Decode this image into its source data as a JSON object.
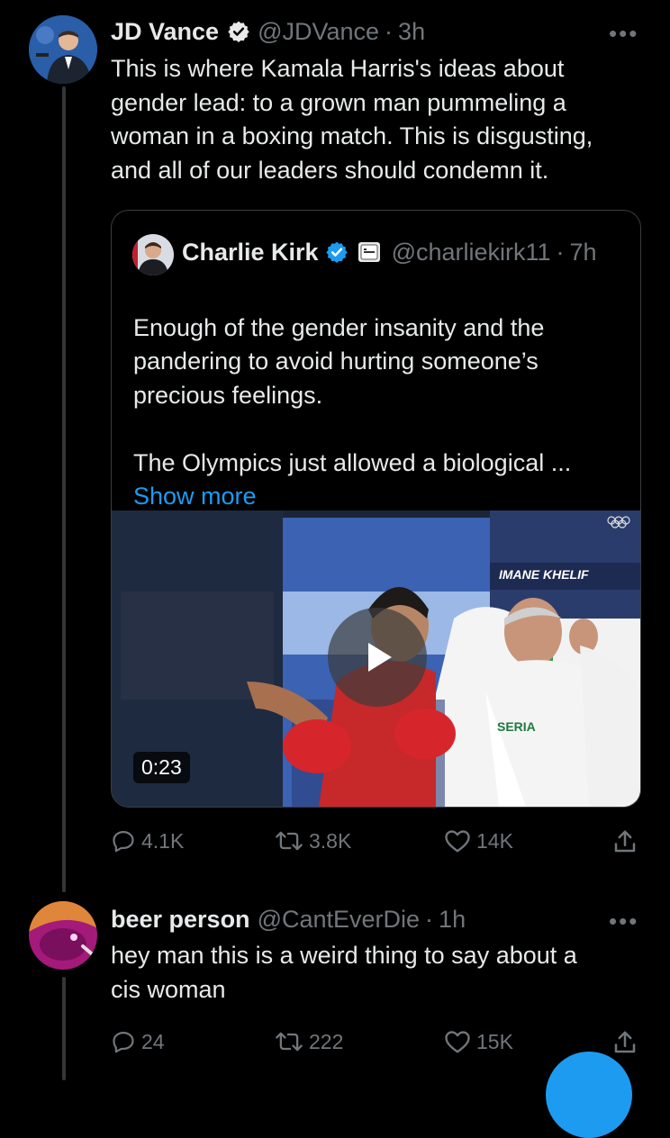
{
  "tweet1": {
    "name": "JD Vance",
    "handle": "@JDVance",
    "separator": "·",
    "time": "3h",
    "text": "This is where Kamala Harris's ideas about\ngender lead: to a grown man pummeling a\nwoman in a boxing match. This is disgusting,\nand all of our leaders should condemn it.",
    "quote": {
      "name": "Charlie Kirk",
      "handle": "@charliekirk11",
      "separator": "·",
      "time": "7h",
      "text": "Enough of the gender insanity and the\npandering to avoid hurting someone’s\nprecious feelings.\n\nThe Olympics just allowed a biological ...",
      "show_more": "Show more",
      "video": {
        "duration": "0:23",
        "overlay_name": "IMANE KHELIF",
        "shirt_text": "SERIA"
      }
    },
    "actions": {
      "replies": "4.1K",
      "retweets": "3.8K",
      "likes": "14K"
    }
  },
  "tweet2": {
    "name": "beer person",
    "handle": "@CantEverDie",
    "separator": "·",
    "time": "1h",
    "text": "hey man this is a weird thing to say about a\ncis woman",
    "actions": {
      "replies": "24",
      "retweets": "222",
      "likes": "15K"
    }
  },
  "more_glyph": "•••",
  "colors": {
    "accent": "#1d9bf0",
    "muted": "#71767b",
    "text": "#e7e9ea",
    "background": "#000000"
  }
}
